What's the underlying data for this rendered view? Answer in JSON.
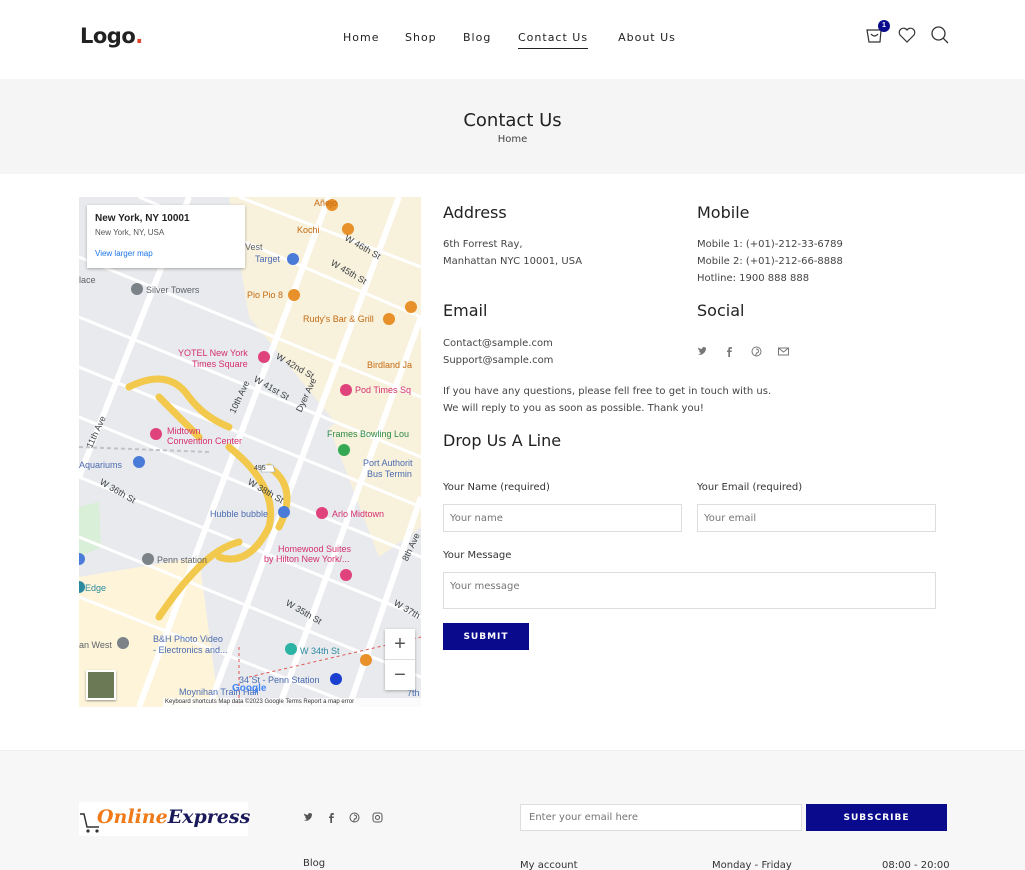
{
  "header": {
    "logo_text": "Logo",
    "logo_dot": ".",
    "nav": [
      {
        "label": "Home"
      },
      {
        "label": "Shop"
      },
      {
        "label": "Blog"
      },
      {
        "label": "Contact Us"
      },
      {
        "label": "About Us"
      }
    ],
    "cart_count": "1"
  },
  "band": {
    "title": "Contact Us",
    "breadcrumb": "Home"
  },
  "map": {
    "card_title": "New York, NY 10001",
    "card_subtitle": "New York, NY, USA",
    "card_link": "View larger map",
    "zoom_in": "+",
    "zoom_out": "−",
    "google": "Google",
    "footer": "Keyboard shortcuts   Map data ©2023 Google   Terms   Report a map error",
    "labels": [
      "Silver Towers",
      "Pio Pio 8",
      "Rudy's Bar & Grill",
      "YOTEL New York",
      "Times Square",
      "Birdland Ja",
      "Pod Times Sq",
      "Midtown",
      "Convention Center",
      "Frames Bowling Lou",
      "Port Authorit",
      "Bus Termin",
      "Aquariums",
      "Hubble bubble",
      "Arlo Midtown",
      "Homewood Suites",
      "by Hilton New York/...",
      "Penn station",
      "Edge",
      "B&H Photo Video",
      "- Electronics and...",
      "W 34th St",
      "an West",
      "34 St - Penn Station",
      "Moynihan Train Hall",
      "Target",
      "Kochi",
      "Añejo",
      "W 42nd St",
      "W 41st St",
      "10th Ave",
      "Dyer Ave",
      "W 38th St",
      "W 36th St",
      "W 35th St",
      "8th Ave",
      "W 37th St",
      "W 45th St",
      "W 46th St",
      "11th Ave",
      "495",
      "lace",
      "Vest",
      "7th"
    ]
  },
  "address": {
    "heading": "Address",
    "line1": "6th Forrest Ray,",
    "line2": "Manhattan NYC 10001, USA"
  },
  "mobile": {
    "heading": "Mobile",
    "line1": "Mobile 1: (+01)-212-33-6789",
    "line2": "Mobile 2: (+01)-212-66-8888",
    "line3": "Hotline: 1900 888 888"
  },
  "email": {
    "heading": "Email",
    "line1": "Contact@sample.com",
    "line2": "Support@sample.com"
  },
  "social": {
    "heading": "Social",
    "icons": [
      "twitter-icon",
      "facebook-icon",
      "pinterest-icon",
      "mail-icon"
    ]
  },
  "note": {
    "line1": "If you have any questions, please fell free to get in touch with us.",
    "line2": "We will reply to you as soon as possible. Thank you!"
  },
  "form": {
    "heading": "Drop Us A Line",
    "name_label": "Your Name (required)",
    "name_placeholder": "Your name",
    "email_label": "Your Email (required)",
    "email_placeholder": "Your email",
    "message_label": "Your Message",
    "message_placeholder": "Your message",
    "submit": "SUBMIT"
  },
  "footer": {
    "logo_part1": "Online",
    "logo_part2": "Express",
    "newsletter_placeholder": "Enter your email here",
    "subscribe": "SUBSCRIBE",
    "link_blog": "Blog",
    "link_account": "My account",
    "hours_days": "Monday - Friday",
    "hours_time": "08:00 - 20:00"
  },
  "colors": {
    "accent": "#0a0a8c",
    "logo_dot": "#e0472e",
    "band_bg": "#f5f5f5"
  }
}
